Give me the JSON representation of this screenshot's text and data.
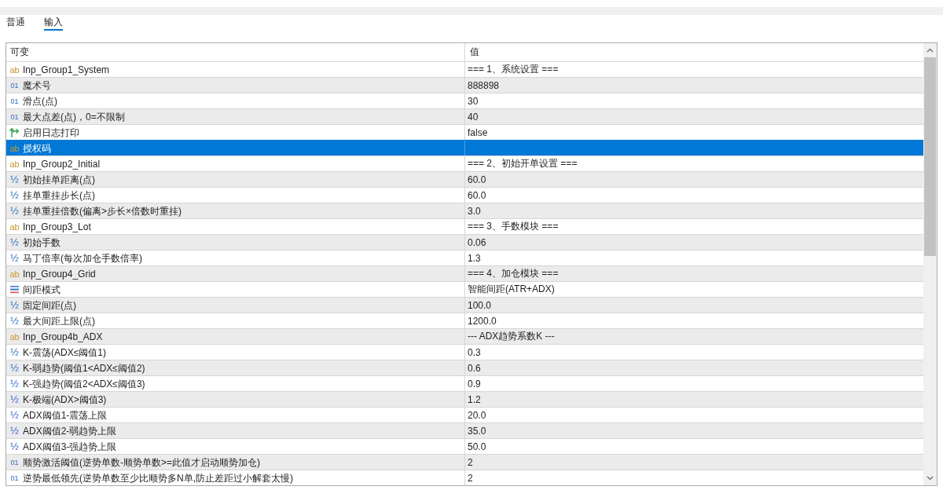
{
  "tabs": [
    {
      "label": "普通",
      "selected": false
    },
    {
      "label": "输入",
      "selected": true
    }
  ],
  "table": {
    "columns": [
      "可变",
      "值"
    ],
    "rows": [
      {
        "kind": "string",
        "icon": "ab",
        "name": "Inp_Group1_System",
        "value": "=== 1、系统设置 ===",
        "selected": false
      },
      {
        "kind": "int",
        "icon": "01",
        "name": "魔术号",
        "value": "888898",
        "selected": false
      },
      {
        "kind": "int",
        "icon": "01",
        "name": "滑点(点)",
        "value": "30",
        "selected": false
      },
      {
        "kind": "int",
        "icon": "01",
        "name": "最大点差(点)，0=不限制",
        "value": "40",
        "selected": false
      },
      {
        "kind": "bool",
        "name": "启用日志打印",
        "value": "false",
        "selected": false
      },
      {
        "kind": "string",
        "icon": "ab",
        "name": "授权码",
        "selected": true
      },
      {
        "kind": "string",
        "icon": "ab",
        "name": "Inp_Group2_Initial",
        "value": "=== 2、初始开单设置 ===",
        "selected": false
      },
      {
        "kind": "double",
        "icon": "½",
        "name": "初始挂单距离(点)",
        "value": "60.0",
        "selected": false
      },
      {
        "kind": "double",
        "icon": "½",
        "name": "挂单重挂步长(点)",
        "value": "60.0",
        "selected": false
      },
      {
        "kind": "double",
        "icon": "½",
        "name": "挂单重挂倍数(偏离>步长×倍数时重挂)",
        "value": "3.0",
        "selected": false
      },
      {
        "kind": "string",
        "icon": "ab",
        "name": "Inp_Group3_Lot",
        "value": "=== 3、手数模块 ===",
        "selected": false
      },
      {
        "kind": "double",
        "icon": "½",
        "name": "初始手数",
        "value": "0.06",
        "selected": false
      },
      {
        "kind": "double",
        "icon": "½",
        "name": "马丁倍率(每次加仓手数倍率)",
        "value": "1.3",
        "selected": false
      },
      {
        "kind": "string",
        "icon": "ab",
        "name": "Inp_Group4_Grid",
        "value": "=== 4、加仓模块 ===",
        "selected": false
      },
      {
        "kind": "enum",
        "name": "间距模式",
        "value": "智能间距(ATR+ADX)",
        "selected": false
      },
      {
        "kind": "double",
        "icon": "½",
        "name": "固定间距(点)",
        "value": "100.0",
        "selected": false
      },
      {
        "kind": "double",
        "icon": "½",
        "name": "最大间距上限(点)",
        "value": "1200.0",
        "selected": false
      },
      {
        "kind": "string",
        "icon": "ab",
        "name": "Inp_Group4b_ADX",
        "value": "--- ADX趋势系数K ---",
        "selected": false
      },
      {
        "kind": "double",
        "icon": "½",
        "name": "K-震荡(ADX≤阈值1)",
        "value": "0.3",
        "selected": false
      },
      {
        "kind": "double",
        "icon": "½",
        "name": "K-弱趋势(阈值1<ADX≤阈值2)",
        "value": "0.6",
        "selected": false
      },
      {
        "kind": "double",
        "icon": "½",
        "name": "K-强趋势(阈值2<ADX≤阈值3)",
        "value": "0.9",
        "selected": false
      },
      {
        "kind": "double",
        "icon": "½",
        "name": "K-极端(ADX>阈值3)",
        "value": "1.2",
        "selected": false
      },
      {
        "kind": "double",
        "icon": "½",
        "name": "ADX阈值1-震荡上限",
        "value": "20.0",
        "selected": false
      },
      {
        "kind": "double",
        "icon": "½",
        "name": "ADX阈值2-弱趋势上限",
        "value": "35.0",
        "selected": false
      },
      {
        "kind": "double",
        "icon": "½",
        "name": "ADX阈值3-强趋势上限",
        "value": "50.0",
        "selected": false
      },
      {
        "kind": "int",
        "icon": "01",
        "name": "顺势激活阈值(逆势单数-顺势单数>=此值才启动顺势加仓)",
        "value": "2",
        "selected": false
      },
      {
        "kind": "int",
        "icon": "01",
        "name": "逆势最低领先(逆势单数至少比顺势多N单,防止差距过小解套太慢)",
        "value": "2",
        "selected": false
      }
    ]
  }
}
